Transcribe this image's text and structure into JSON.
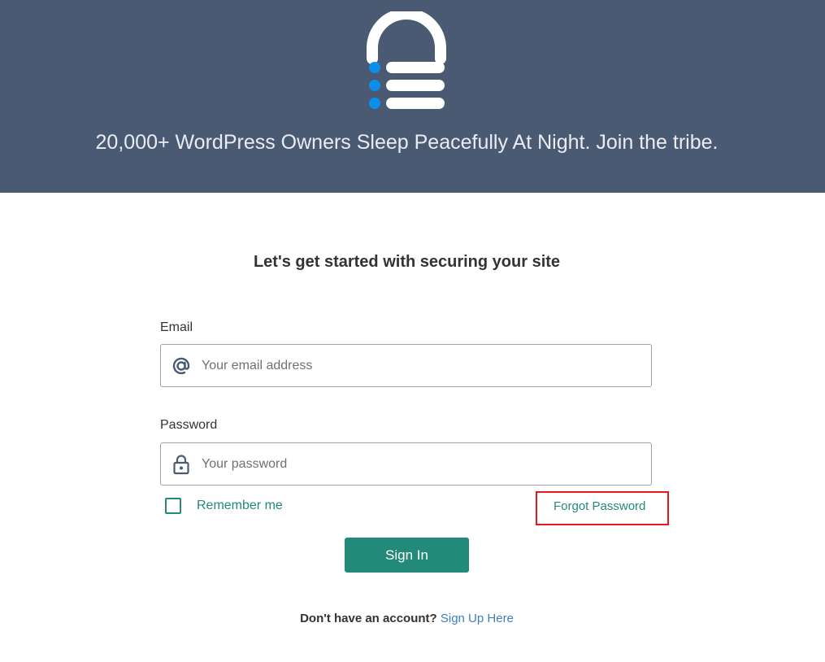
{
  "header": {
    "tagline": "20,000+ WordPress Owners Sleep Peacefully At Night. Join the tribe.",
    "background_color": "#4b5a73",
    "logo_icon": "lock-logo-icon"
  },
  "form": {
    "title": "Let's get started with securing your site",
    "email": {
      "label": "Email",
      "placeholder": "Your email address",
      "value": "",
      "icon": "at-sign-icon"
    },
    "password": {
      "label": "Password",
      "placeholder": "Your password",
      "value": "",
      "icon": "lock-icon"
    },
    "remember_me": {
      "label": "Remember me",
      "checked": false
    },
    "forgot_password": "Forgot Password",
    "sign_in": "Sign In",
    "signup_prompt": "Don't have an account?",
    "signup_link": "Sign Up Here"
  },
  "colors": {
    "accent": "#238a79",
    "link": "#3d7fbf",
    "logo_dots": "#0b8fe8",
    "highlight": "#e5191b"
  }
}
